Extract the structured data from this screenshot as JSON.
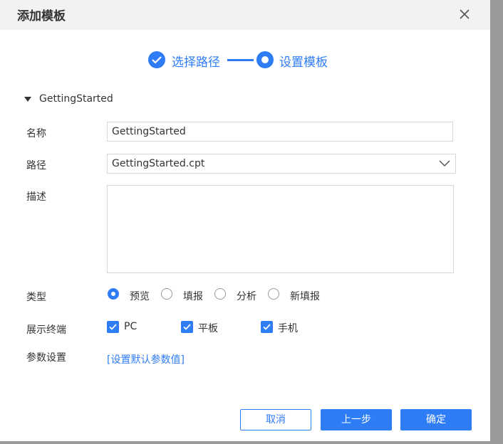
{
  "dialog": {
    "title": "添加模板",
    "close_icon": "close-icon"
  },
  "steps": [
    {
      "label": "选择路径",
      "state": "done",
      "icon": "check-circle-icon"
    },
    {
      "label": "设置模板",
      "state": "current",
      "icon": "current-step-icon"
    }
  ],
  "section": {
    "label": "GettingStarted",
    "expanded": true
  },
  "form": {
    "name_label": "名称",
    "name_value": "GettingStarted",
    "path_label": "路径",
    "path_value": "GettingStarted.cpt",
    "desc_label": "描述",
    "desc_value": "",
    "type_label": "类型",
    "type_options": [
      "预览",
      "填报",
      "分析",
      "新填报"
    ],
    "type_selected": "预览",
    "display_label": "展示终端",
    "display_options": [
      {
        "label": "PC",
        "checked": true
      },
      {
        "label": "平板",
        "checked": true
      },
      {
        "label": "手机",
        "checked": true
      }
    ],
    "param_label": "参数设置",
    "param_link": "[设置默认参数值]"
  },
  "buttons": {
    "cancel": "取消",
    "prev": "上一步",
    "confirm": "确定"
  },
  "colors": {
    "accent": "#2e7cf6",
    "titlebar_bg": "#f1f2f4",
    "border": "#d6d6d6",
    "backdrop": "#9a9a9a"
  }
}
